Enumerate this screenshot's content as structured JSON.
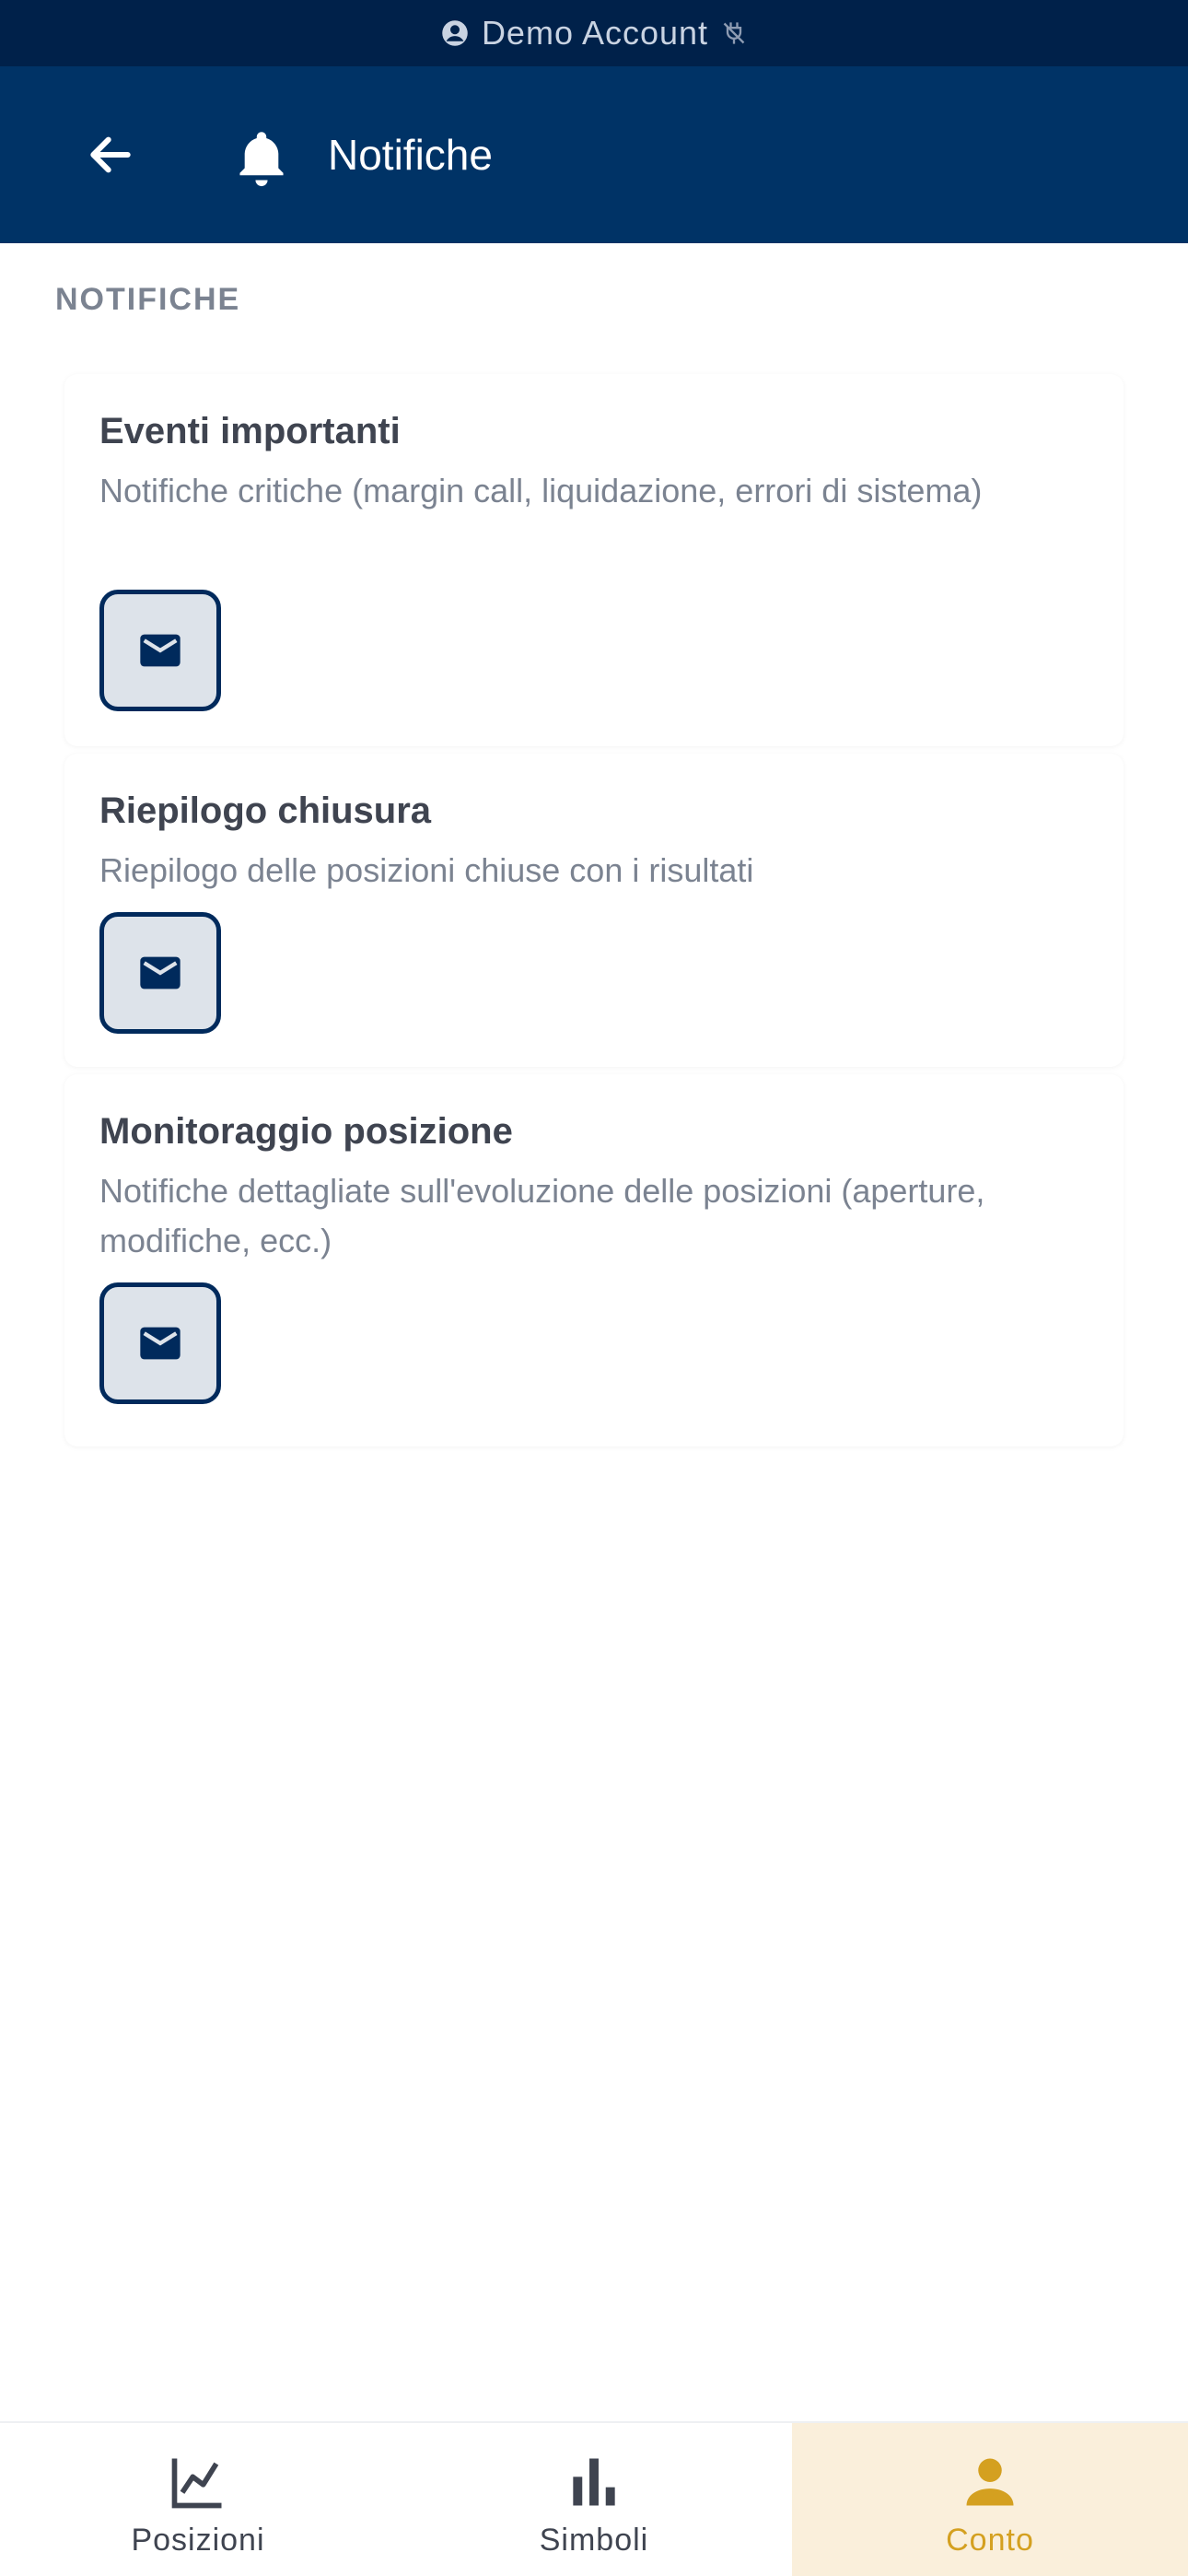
{
  "status_bar": {
    "account_label": "Demo Account",
    "account_icon": "account-circle-icon",
    "connection_icon": "plug-off-icon"
  },
  "header": {
    "back_icon": "arrow-left-icon",
    "title_icon": "bell-icon",
    "title": "Notifiche"
  },
  "section": {
    "label": "NOTIFICHE"
  },
  "cards": [
    {
      "title": "Eventi importanti",
      "description": "Notifiche critiche (margin call, liquidazione, errori di sistema)",
      "channel_icon": "mail-icon"
    },
    {
      "title": "Riepilogo chiusura",
      "description": "Riepilogo delle posizioni chiuse con i risultati",
      "channel_icon": "mail-icon"
    },
    {
      "title": "Monitoraggio posizione",
      "description": "Notifiche dettagliate sull'evoluzione delle posizioni (aperture, modifiche, ecc.)",
      "channel_icon": "mail-icon"
    }
  ],
  "bottom_nav": {
    "items": [
      {
        "label": "Posizioni",
        "icon": "line-chart-icon",
        "active": false
      },
      {
        "label": "Simboli",
        "icon": "bar-chart-icon",
        "active": false
      },
      {
        "label": "Conto",
        "icon": "person-icon",
        "active": true
      }
    ]
  },
  "colors": {
    "status_bar_bg": "#00214a",
    "header_bg": "#003366",
    "accent": "#d4a020",
    "active_tab_bg": "#faefdb",
    "mail_button_bg": "#dde3ea",
    "mail_button_border": "#002a5c"
  }
}
